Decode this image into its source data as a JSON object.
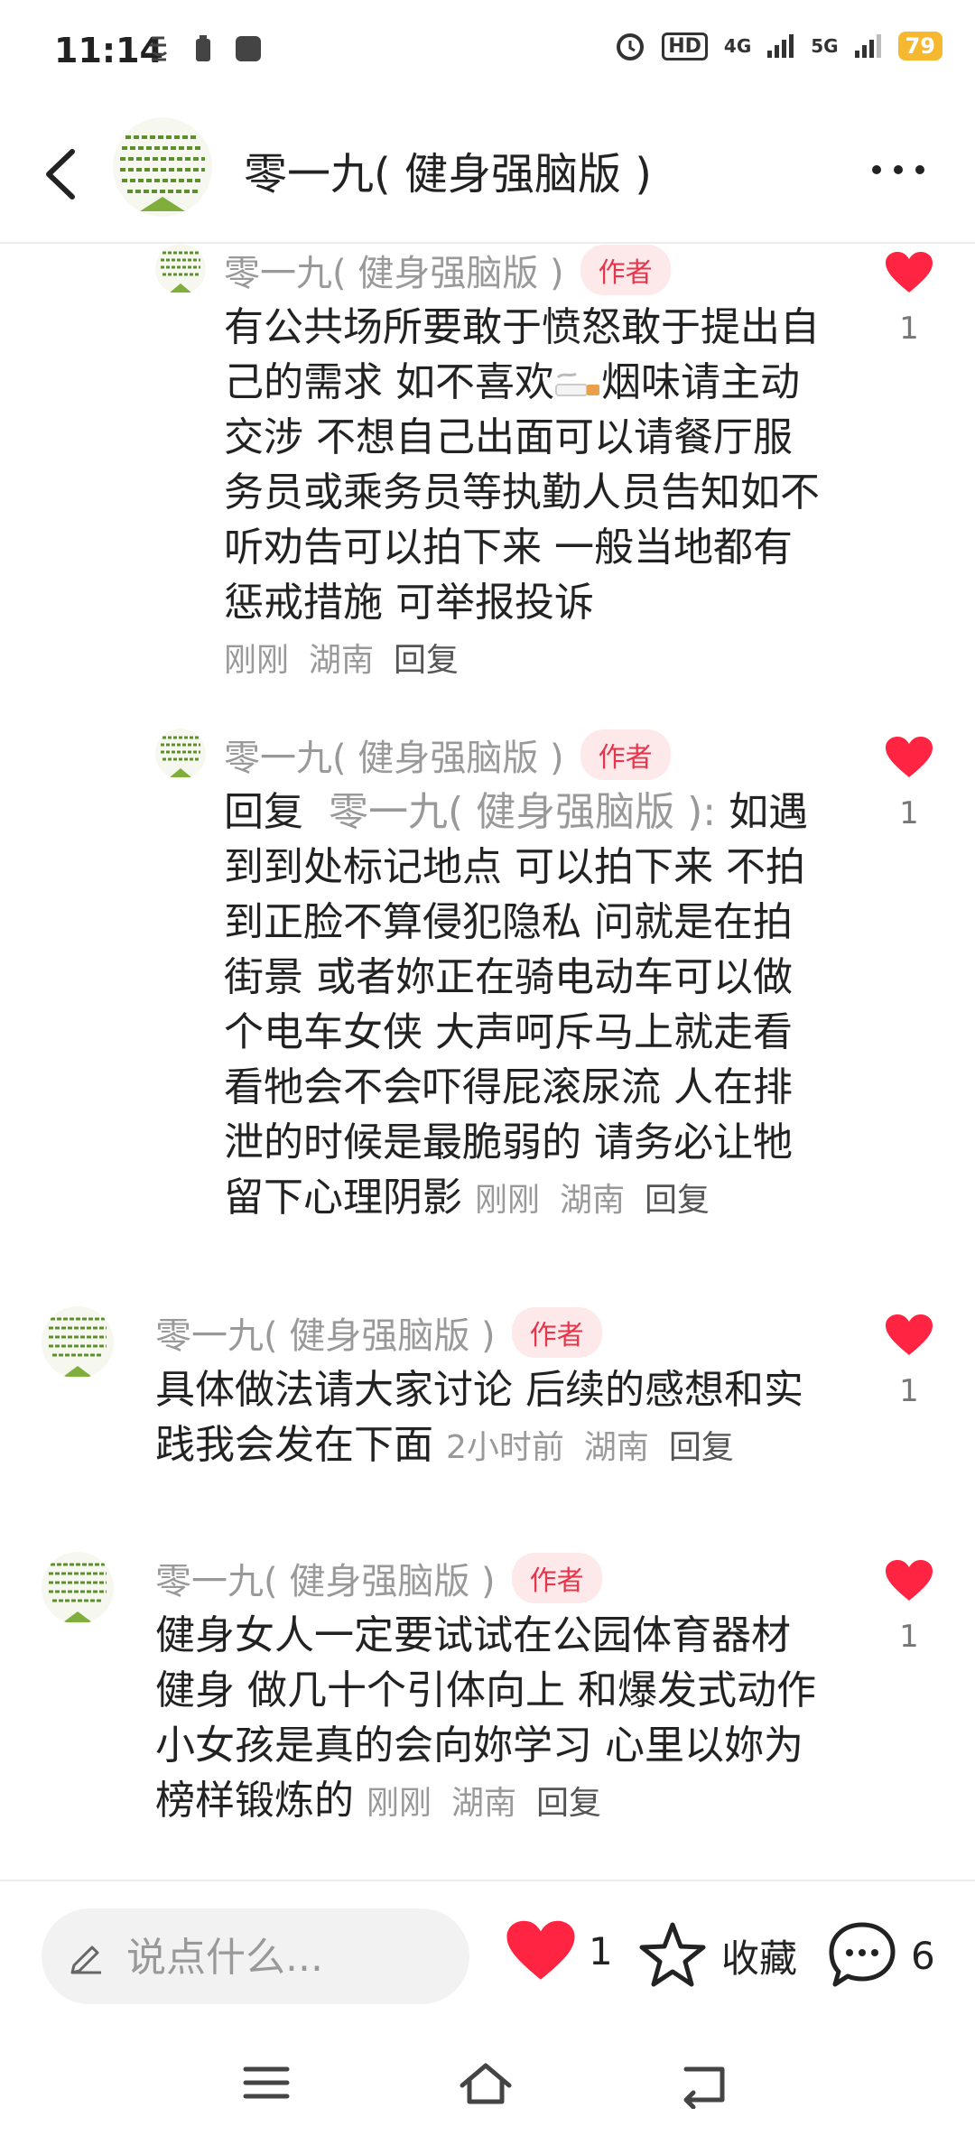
{
  "status_bar": {
    "time": "11:14",
    "hd_label": "HD",
    "net_4g": "4G",
    "net_5g": "5G",
    "battery": "79"
  },
  "header": {
    "title": "零一九( 健身强脑版 )"
  },
  "comments": [
    {
      "author": "零一九( 健身强脑版 )",
      "badge": "作者",
      "text_before": "有公共场所要敢于愤怒敢于提出自己的需求 如不喜欢",
      "text_after": "烟味请主动交涉 不想自己出面可以请餐厅服务员或乘务员等执勤人员告知如不听劝告可以拍下来 一般当地都有惩戒措施 可举报投诉",
      "time": "刚刚",
      "location": "湖南",
      "reply": "回复",
      "likes": "1"
    },
    {
      "author": "零一九( 健身强脑版 )",
      "badge": "作者",
      "reply_prefix": "回复",
      "reply_to": "零一九( 健身强脑版 ):",
      "text": "如遇到到处标记地点 可以拍下来 不拍到正脸不算侵犯隐私 问就是在拍街景 或者妳正在骑电动车可以做个电车女侠 大声呵斥马上就走看看牠会不会吓得屁滚尿流 人在排泄的时候是最脆弱的 请务必让牠留下心理阴影",
      "time": "刚刚",
      "location": "湖南",
      "reply": "回复",
      "likes": "1"
    },
    {
      "author": "零一九( 健身强脑版 )",
      "badge": "作者",
      "text": "具体做法请大家讨论 后续的感想和实践我会发在下面",
      "time": "2小时前",
      "location": "湖南",
      "reply": "回复",
      "likes": "1"
    },
    {
      "author": "零一九( 健身强脑版 )",
      "badge": "作者",
      "text": "健身女人一定要试试在公园体育器材健身 做几十个引体向上 和爆发式动作 小女孩是真的会向妳学习 心里以妳为榜样锻炼的",
      "time": "刚刚",
      "location": "湖南",
      "reply": "回复",
      "likes": "1"
    }
  ],
  "bottom_bar": {
    "input_placeholder": "说点什么...",
    "like_count": "1",
    "favorite_label": "收藏",
    "comment_count": "6"
  },
  "colors": {
    "accent_red": "#ff2442",
    "badge_bg": "#fde8ea",
    "meta_gray": "#999999"
  },
  "icons": {
    "back": "chevron-left-icon",
    "more": "more-dots-icon",
    "like": "heart-icon",
    "favorite": "star-icon",
    "comment": "chat-bubble-icon",
    "edit": "pencil-icon",
    "nav_menu": "menu-icon",
    "nav_home": "home-icon",
    "nav_back": "return-icon"
  }
}
